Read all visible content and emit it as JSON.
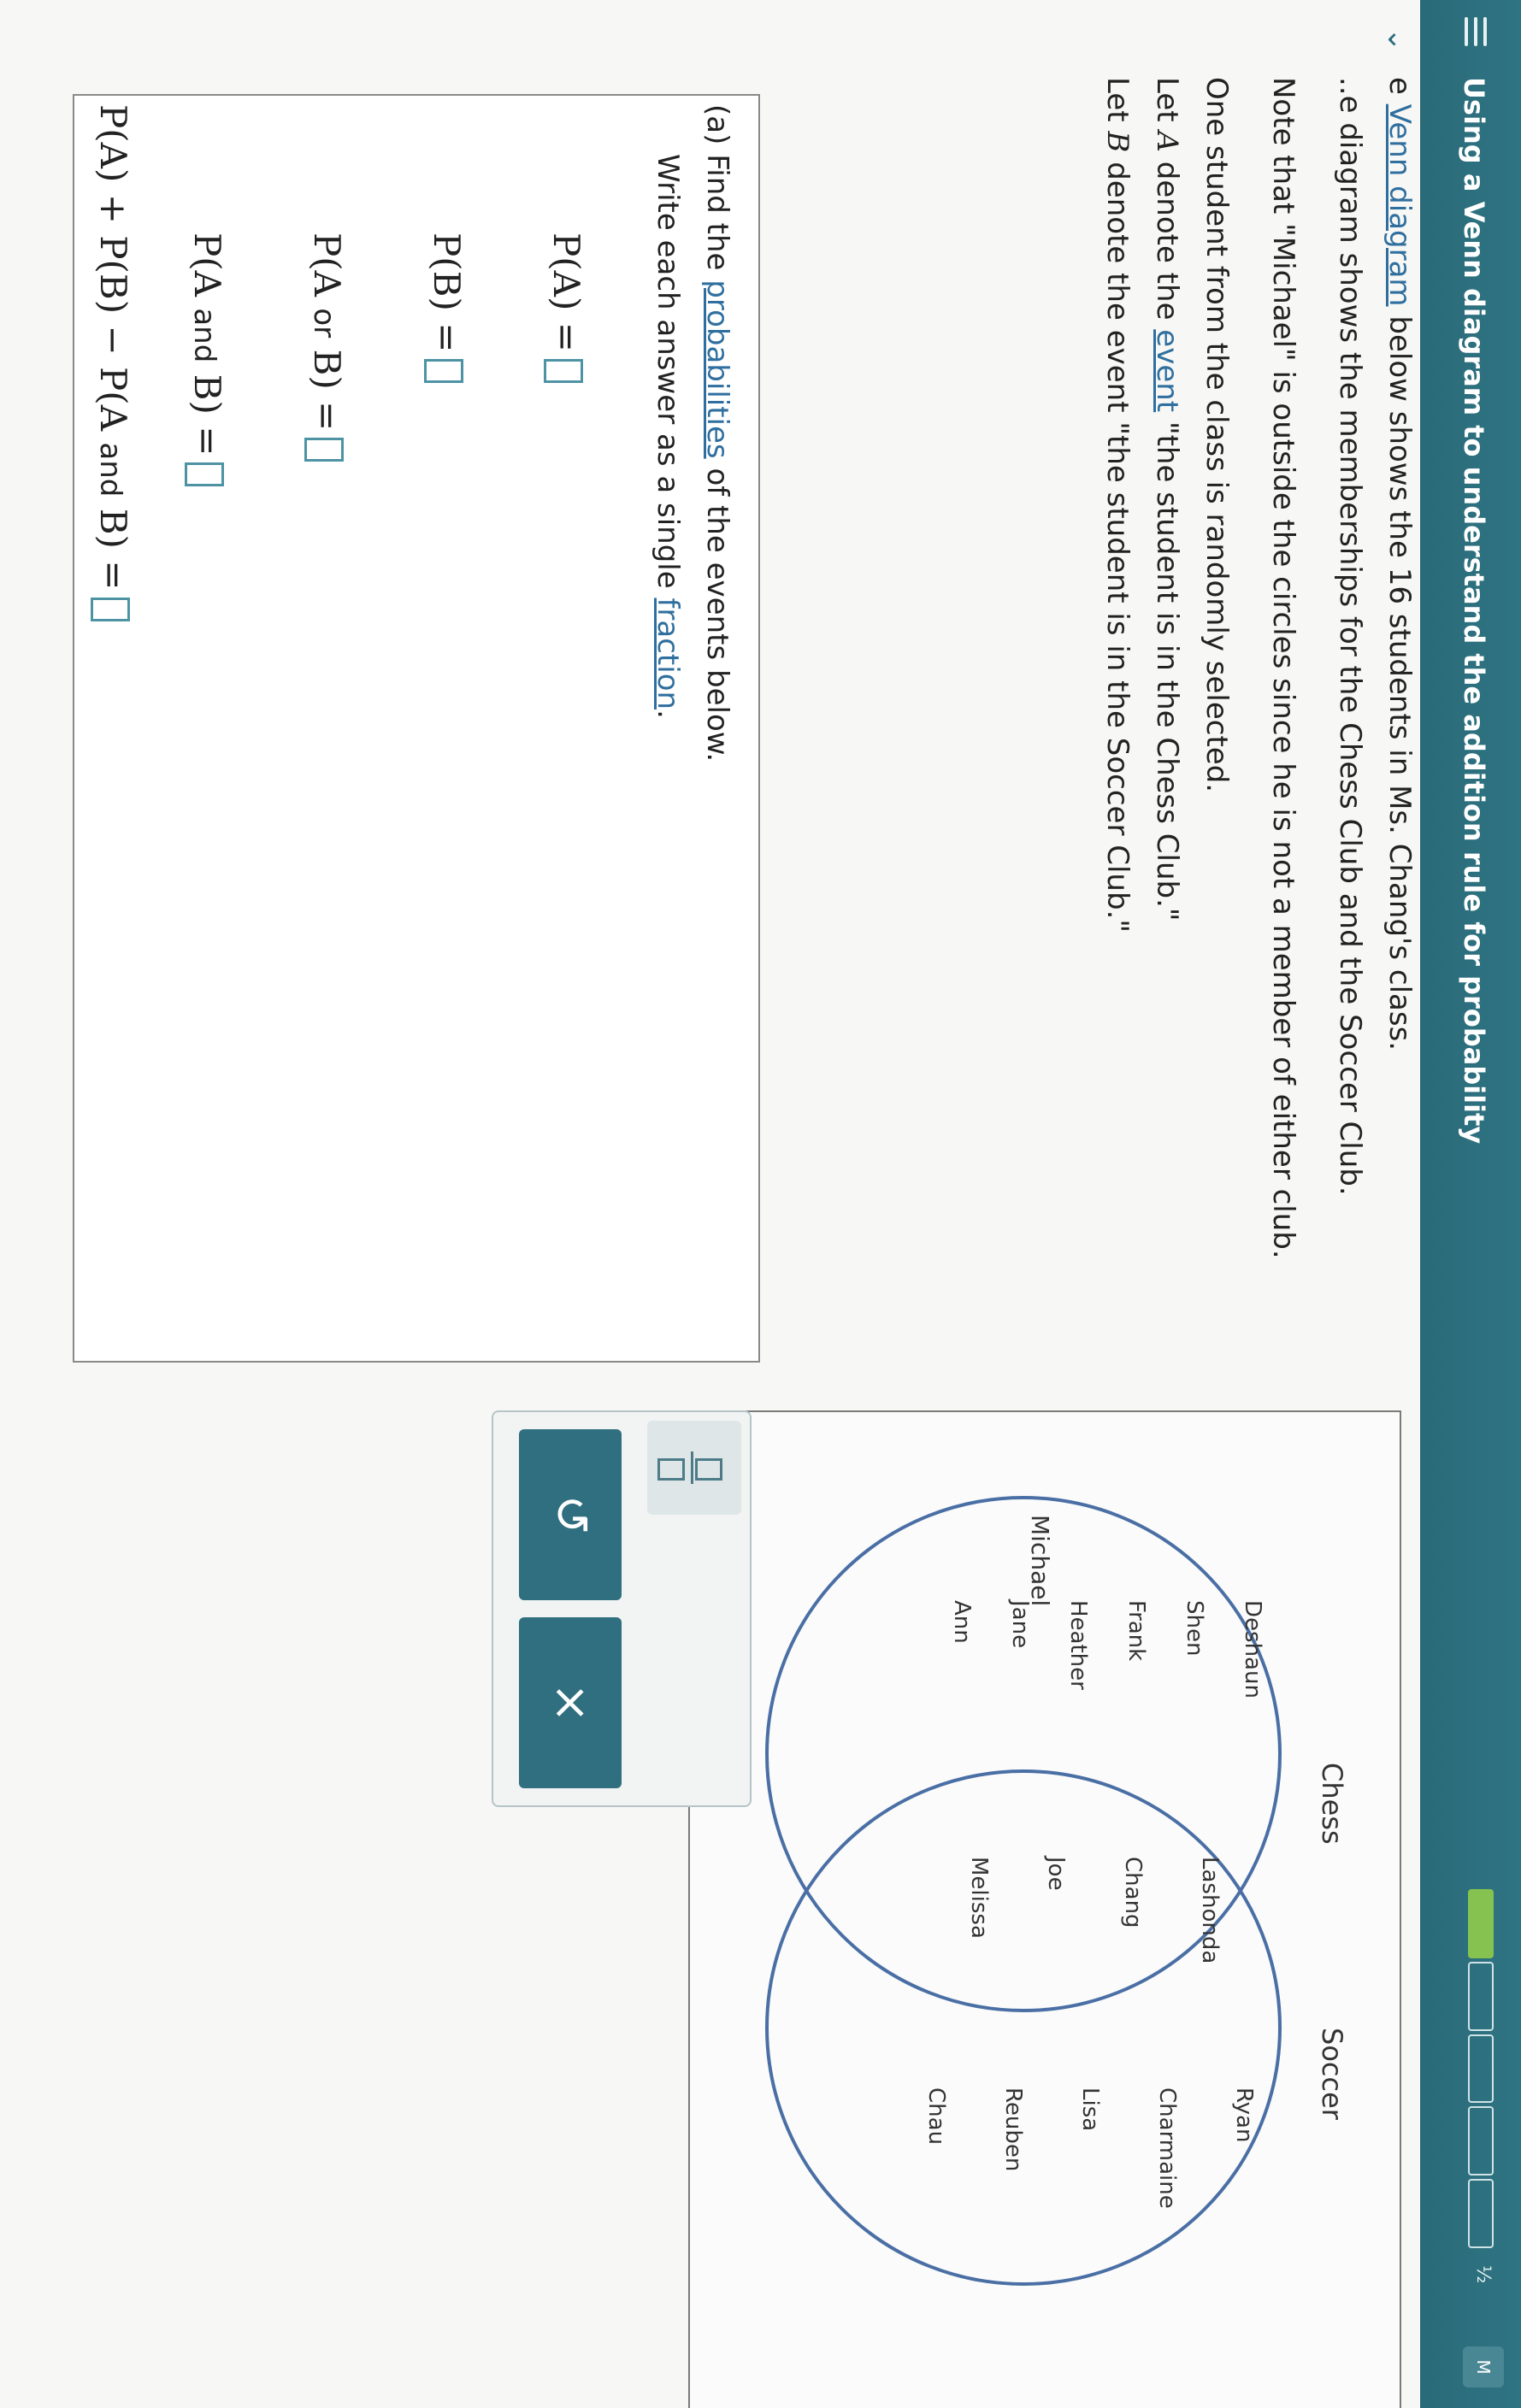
{
  "header": {
    "title": "Using a Venn diagram to understand the addition rule for probability",
    "progress": {
      "completed": 1,
      "total": 5
    },
    "progress_label": "½",
    "avatar_label": "M"
  },
  "intro": {
    "line1_pre": "e ",
    "line1_link": "Venn diagram",
    "line1_post": " below shows the 16 students in Ms. Chang's class.",
    "line2": "..e diagram shows the memberships for the Chess Club and the Soccer Club.",
    "note": "Note that \"Michael\" is outside the circles since he is not a member of either club.",
    "selected": "One student from the class is randomly selected.",
    "let_a_pre": "Let ",
    "let_a_var": "A",
    "let_a_mid": " denote the ",
    "let_a_link": "event",
    "let_a_post": " \"the student is in the Chess Club.\"",
    "let_b_pre": "Let ",
    "let_b_var": "B",
    "let_b_post": " denote the event \"the student is in the Soccer Club.\""
  },
  "venn": {
    "chess_label": "Chess",
    "soccer_label": "Soccer",
    "chess_only": [
      "Deshaun",
      "Shen",
      "Frank",
      "Heather",
      "Jane",
      "Ann"
    ],
    "both": [
      "Lashonda",
      "Chang",
      "Joe",
      "Melissa"
    ],
    "soccer_only": [
      "Ryan",
      "Charmaine",
      "Lisa",
      "Reuben",
      "Chau"
    ],
    "outside": "Michael",
    "circle_color": "#4a6fa5"
  },
  "question": {
    "part_label": "(a)",
    "line1_pre": "Find the ",
    "line1_link": "probabilities",
    "line1_post": " of the events below.",
    "line2_pre": "Write each answer as a single ",
    "line2_link": "fraction",
    "line2_post": ".",
    "eq1": "P(A) =",
    "eq2": "P(B) =",
    "eq3_pre": "P(A ",
    "eq3_or": "or",
    "eq3_post": " B) =",
    "eq4_pre": "P(A ",
    "eq4_and": "and",
    "eq4_post": " B) =",
    "eq5_pre": "P(A) + P(B) − P(A ",
    "eq5_and": "and",
    "eq5_post": " B) ="
  },
  "tools": {
    "undo_icon": "↺",
    "clear_icon": "×"
  }
}
